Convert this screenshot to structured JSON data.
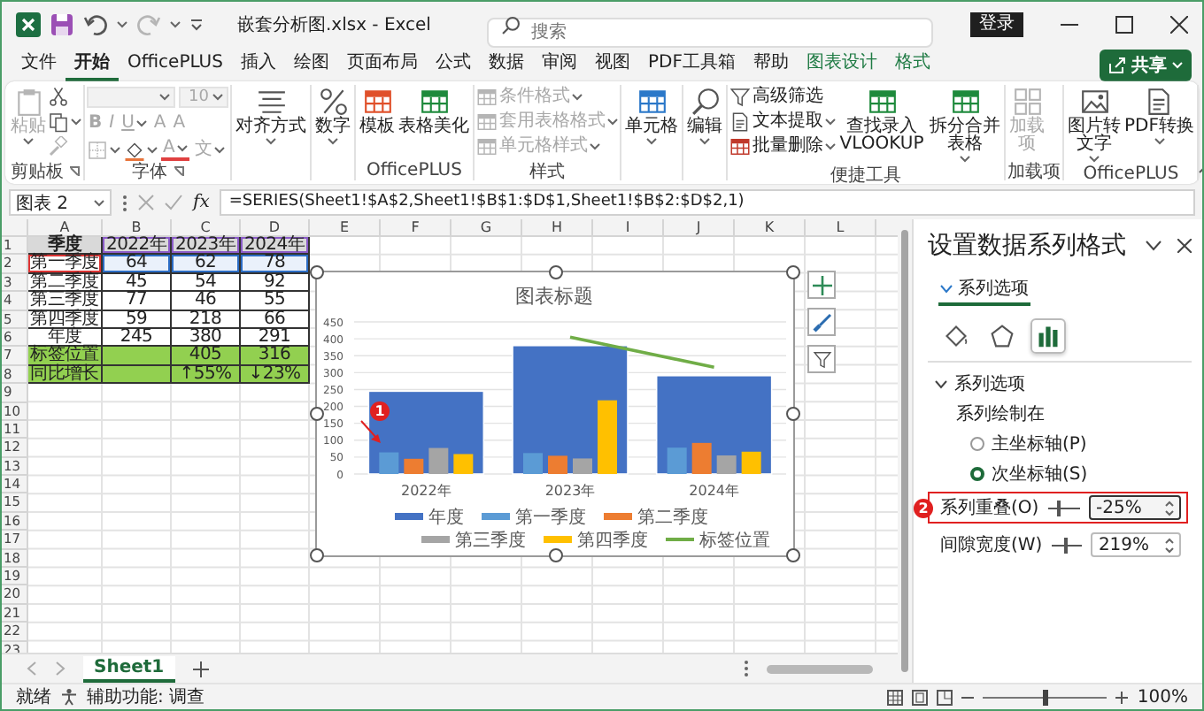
{
  "title_bar": {
    "file_title": "嵌套分析图.xlsx  -  Excel",
    "search": {
      "placeholder": "搜索"
    },
    "sign_in": "登录"
  },
  "menu_tabs": [
    {
      "label": "文件",
      "selected": false,
      "contextual": false
    },
    {
      "label": "开始",
      "selected": true,
      "contextual": false
    },
    {
      "label": "OfficePLUS",
      "selected": false,
      "contextual": false
    },
    {
      "label": "插入",
      "selected": false,
      "contextual": false
    },
    {
      "label": "绘图",
      "selected": false,
      "contextual": false
    },
    {
      "label": "页面布局",
      "selected": false,
      "contextual": false
    },
    {
      "label": "公式",
      "selected": false,
      "contextual": false
    },
    {
      "label": "数据",
      "selected": false,
      "contextual": false
    },
    {
      "label": "审阅",
      "selected": false,
      "contextual": false
    },
    {
      "label": "视图",
      "selected": false,
      "contextual": false
    },
    {
      "label": "PDF工具箱",
      "selected": false,
      "contextual": false
    },
    {
      "label": "帮助",
      "selected": false,
      "contextual": false
    },
    {
      "label": "图表设计",
      "selected": false,
      "contextual": true
    },
    {
      "label": "格式",
      "selected": false,
      "contextual": true
    }
  ],
  "share_button": "共享",
  "ribbon": [
    {
      "label": "剪贴板",
      "launcher": true,
      "items": [
        {
          "kind": "large",
          "label": "粘贴",
          "disabled": true,
          "menu": true
        },
        {
          "kind": "icon",
          "disabled": false,
          "menu": false
        },
        {
          "kind": "icon",
          "disabled": false,
          "menu": true
        },
        {
          "kind": "icon",
          "disabled": true,
          "menu": false
        }
      ]
    },
    {
      "label": "字体",
      "launcher": true,
      "font_name": {
        "disabled": true
      },
      "font_size": {
        "value": "10",
        "disabled": true
      },
      "items": [
        {
          "kind": "text",
          "label": "B",
          "disabled": true,
          "menu": false
        },
        {
          "kind": "text",
          "label": "I",
          "disabled": true,
          "menu": false
        },
        {
          "kind": "text",
          "label": "U",
          "disabled": true,
          "menu": true
        },
        {
          "kind": "text",
          "label": "A",
          "disabled": true,
          "menu": false
        },
        {
          "kind": "text",
          "label": "A",
          "disabled": true,
          "menu": false
        },
        {
          "kind": "icon",
          "disabled": true,
          "menu": true
        },
        {
          "kind": "icon",
          "disabled": false,
          "menu": true
        },
        {
          "kind": "text",
          "label": "A",
          "disabled": true,
          "menu": true
        },
        {
          "kind": "text",
          "label": "文",
          "disabled": true,
          "menu": true
        }
      ]
    },
    {
      "items": [
        {
          "kind": "large",
          "label": "对齐方式",
          "disabled": false,
          "menu": true
        }
      ]
    },
    {
      "items": [
        {
          "kind": "large",
          "label": "数字",
          "disabled": false,
          "menu": true
        }
      ]
    },
    {
      "label": "OfficePLUS",
      "items": [
        {
          "kind": "large",
          "label": "模板",
          "disabled": false,
          "menu": false
        },
        {
          "kind": "large",
          "label": "表格美化",
          "disabled": false,
          "menu": false
        }
      ]
    },
    {
      "label": "样式",
      "items": [
        {
          "kind": "small",
          "label": "条件格式",
          "disabled": true,
          "menu": true
        },
        {
          "kind": "small",
          "label": "套用表格格式",
          "disabled": true,
          "menu": true
        },
        {
          "kind": "small",
          "label": "单元格样式",
          "disabled": true,
          "menu": true
        }
      ]
    },
    {
      "items": [
        {
          "kind": "large",
          "label": "单元格",
          "disabled": false,
          "menu": true
        }
      ]
    },
    {
      "items": [
        {
          "kind": "large",
          "label": "编辑",
          "disabled": false,
          "menu": true
        }
      ]
    },
    {
      "label": "便捷工具",
      "items": [
        {
          "kind": "small",
          "label": "高级筛选",
          "disabled": false,
          "menu": false
        },
        {
          "kind": "small",
          "label": "文本提取",
          "disabled": false,
          "menu": true
        },
        {
          "kind": "small",
          "label": "批量删除",
          "disabled": false,
          "menu": true
        },
        {
          "kind": "large",
          "label": "查找录入VLOOKUP",
          "disabled": false,
          "menu": false
        },
        {
          "kind": "large",
          "label": "拆分合并表格",
          "disabled": false,
          "menu": true
        }
      ]
    },
    {
      "label": "加载项",
      "items": [
        {
          "kind": "large",
          "label": "加载项",
          "disabled": true,
          "menu": false
        }
      ]
    },
    {
      "label": "OfficePLUS",
      "items": [
        {
          "kind": "large",
          "label": "图片转文字",
          "disabled": false,
          "menu": true
        },
        {
          "kind": "large",
          "label": "PDF转换",
          "disabled": false,
          "menu": true
        }
      ]
    }
  ],
  "formula_bar": {
    "name_box": "图表 2",
    "function_button": "fx",
    "formula": "=SERIES(Sheet1!$A$2,Sheet1!$B$1:$D$1,Sheet1!$B$2:$D$2,1)"
  },
  "sheet": {
    "columns": [
      "A",
      "B",
      "C",
      "D",
      "E",
      "F",
      "G",
      "H",
      "I",
      "J",
      "K",
      "L"
    ],
    "rows": [
      {
        "row": "1",
        "kind": "header",
        "cells": [
          "季度",
          "2022年",
          "2023年",
          "2024年"
        ]
      },
      {
        "row": "2",
        "kind": "series",
        "cells": [
          "第一季度",
          "64",
          "62",
          "78"
        ]
      },
      {
        "row": "3",
        "kind": "data",
        "cells": [
          "第二季度",
          "45",
          "54",
          "92"
        ]
      },
      {
        "row": "4",
        "kind": "data",
        "cells": [
          "第三季度",
          "77",
          "46",
          "55"
        ]
      },
      {
        "row": "5",
        "kind": "data",
        "cells": [
          "第四季度",
          "59",
          "218",
          "66"
        ]
      },
      {
        "row": "6",
        "kind": "data",
        "cells": [
          "年度",
          "245",
          "380",
          "291"
        ]
      },
      {
        "row": "7",
        "kind": "green",
        "cells": [
          "标签位置",
          null,
          "405",
          "316"
        ]
      },
      {
        "row": "8",
        "kind": "green",
        "cells": [
          "同比增长",
          null,
          "↑55%",
          "↓23%"
        ]
      },
      {
        "row": "9"
      },
      {
        "row": "10"
      },
      {
        "row": "11"
      },
      {
        "row": "12"
      },
      {
        "row": "13"
      },
      {
        "row": "14"
      },
      {
        "row": "15"
      },
      {
        "row": "16"
      },
      {
        "row": "17"
      },
      {
        "row": "18"
      },
      {
        "row": "19"
      },
      {
        "row": "20"
      },
      {
        "row": "21"
      },
      {
        "row": "22"
      },
      {
        "row": "23"
      }
    ]
  },
  "chart": {
    "callout": "1",
    "chart_data": {
      "type": "bar",
      "title": "图表标题",
      "grid": true,
      "legend": "bottom",
      "categories": [
        "2022年",
        "2023年",
        "2024年"
      ],
      "ylim": [
        0,
        450
      ],
      "yticks": [
        0,
        50,
        100,
        150,
        200,
        250,
        300,
        350,
        400,
        450
      ],
      "series": [
        {
          "name": "年度",
          "color": "#4472c4",
          "values": [
            245,
            380,
            291
          ]
        },
        {
          "name": "第一季度",
          "color": "#5b9bd5",
          "values": [
            64,
            62,
            78
          ]
        },
        {
          "name": "第二季度",
          "color": "#ed7d31",
          "values": [
            45,
            54,
            92
          ]
        },
        {
          "name": "第三季度",
          "color": "#a5a5a5",
          "values": [
            77,
            46,
            55
          ]
        },
        {
          "name": "第四季度",
          "color": "#ffc000",
          "values": [
            59,
            218,
            66
          ]
        },
        {
          "name": "标签位置",
          "color": "#70ad47",
          "type": "line",
          "values": [
            null,
            405,
            316
          ]
        }
      ]
    }
  },
  "format_pane": {
    "title": "设置数据系列格式",
    "tabs": [
      {
        "label": "系列选项",
        "selected": true
      }
    ],
    "icon_tabs": [
      {
        "selected": false
      },
      {
        "selected": false
      },
      {
        "selected": true
      }
    ],
    "section": {
      "label": "系列选项",
      "expanded": true,
      "plot_on": "系列绘制在",
      "radios": [
        {
          "label": "主坐标轴(P)",
          "selected": false
        },
        {
          "label": "次坐标轴(S)",
          "selected": true
        }
      ],
      "settings": [
        {
          "label": "系列重叠(O)",
          "value": "-25%",
          "level": 0.37,
          "focused": true,
          "callout": "2"
        },
        {
          "label": "间隙宽度(W)",
          "value": "219%",
          "level": 0.44,
          "focused": false
        }
      ]
    }
  },
  "sheet_tabs": [
    {
      "label": "Sheet1",
      "selected": true
    }
  ],
  "status_bar": {
    "ready": "就绪",
    "accessibility": "辅助功能: 调查",
    "zoom": "100%",
    "zoom_slider": {
      "level": 0.5
    }
  }
}
